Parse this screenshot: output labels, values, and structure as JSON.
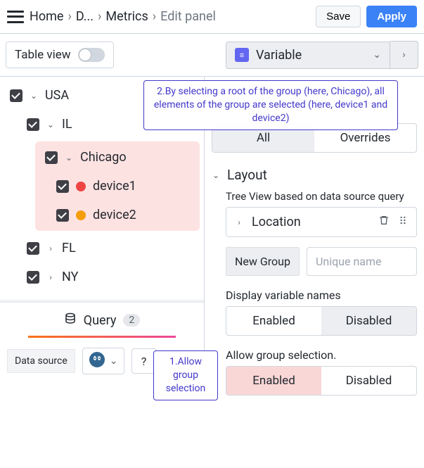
{
  "breadcrumbs": {
    "home": "Home",
    "dash": "D...",
    "metrics": "Metrics",
    "edit": "Edit panel"
  },
  "buttons": {
    "save": "Save",
    "apply": "Apply"
  },
  "tableview_label": "Table view",
  "variable_label": "Variable",
  "tree": {
    "usa": "USA",
    "il": "IL",
    "chicago": "Chicago",
    "device1": "device1",
    "device2": "device2",
    "fl": "FL",
    "ny": "NY"
  },
  "query": {
    "label": "Query",
    "count": "2",
    "datasource_label": "Data source"
  },
  "right": {
    "tab_all": "All",
    "tab_overrides": "Overrides",
    "layout": "Layout",
    "tree_desc": "Tree View based on data source query",
    "location": "Location",
    "new_group": "New Group",
    "unique_placeholder": "Unique name",
    "display_label": "Display variable names",
    "enabled": "Enabled",
    "disabled": "Disabled",
    "allow_label": "Allow group selection."
  },
  "callouts": {
    "c1": "2.By selecting a root of the group (here, Chicago), all elements of the group are selected (here, device1 and device2)",
    "c2": "1.Allow group selection"
  }
}
